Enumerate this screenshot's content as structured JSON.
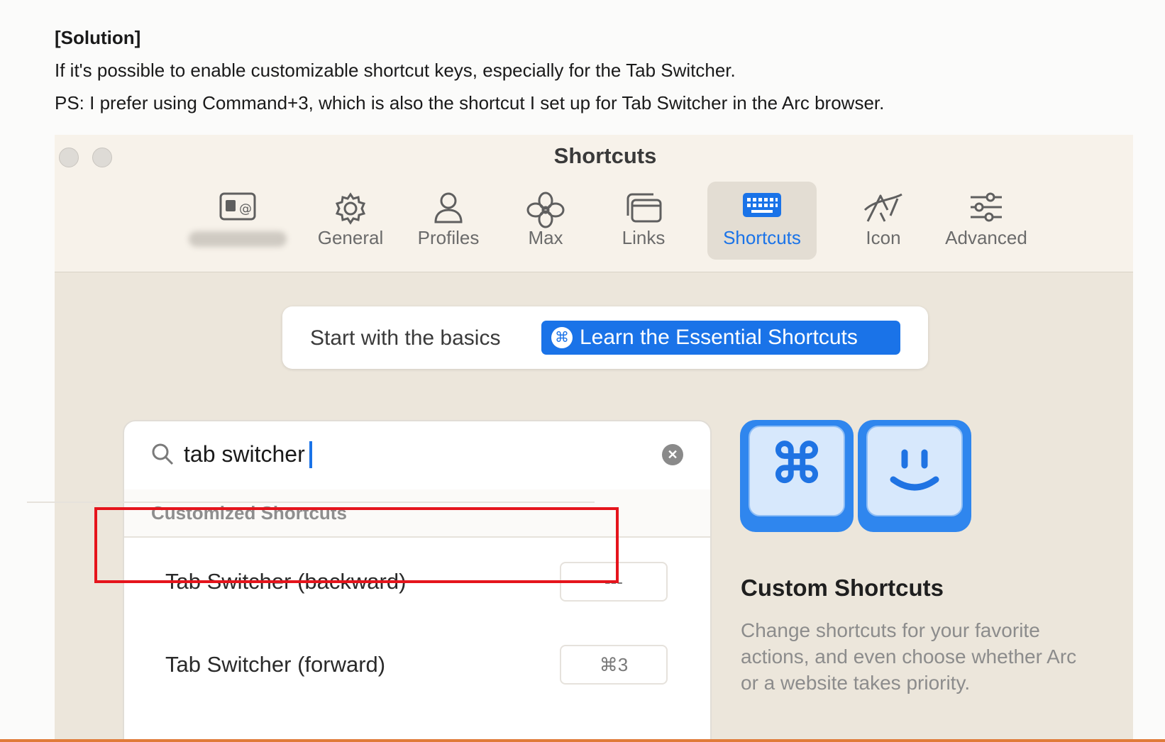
{
  "post": {
    "heading": "[Solution]",
    "line1": "If it's possible to enable customizable shortcut keys, especially for the Tab Switcher.",
    "line2": "PS: I prefer using Command+3, which is also the shortcut I set up for Tab Switcher in the Arc browser."
  },
  "window": {
    "title": "Shortcuts",
    "tabs": [
      {
        "label": "General",
        "icon": "gear-icon"
      },
      {
        "label": "Profiles",
        "icon": "person-icon"
      },
      {
        "label": "Max",
        "icon": "max-flower-icon"
      },
      {
        "label": "Links",
        "icon": "links-icon"
      },
      {
        "label": "Shortcuts",
        "icon": "keyboard-icon",
        "active": true
      },
      {
        "label": "Icon",
        "icon": "arc-logo-icon"
      },
      {
        "label": "Advanced",
        "icon": "sliders-icon"
      }
    ],
    "accent_color": "#1a73e8"
  },
  "basics": {
    "text": "Start with the basics",
    "button_icon": "⌘",
    "button_label": "Learn the Essential Shortcuts"
  },
  "search": {
    "value": "tab switcher"
  },
  "list": {
    "section_header": "Customized Shortcuts",
    "rows": [
      {
        "name": "Tab Switcher (backward)",
        "key": "---"
      },
      {
        "name": "Tab Switcher (forward)",
        "key": "⌘3"
      }
    ]
  },
  "promo": {
    "cmd_key_glyph": "⌘",
    "title": "Custom Shortcuts",
    "description": "Change shortcuts for your favorite actions, and even choose whether Arc or a website takes priority."
  }
}
